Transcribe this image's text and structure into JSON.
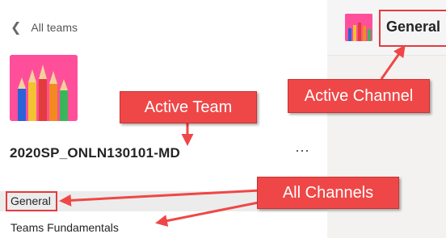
{
  "nav": {
    "back_label": "All teams"
  },
  "team": {
    "name": "2020SP_ONLN130101-MD",
    "more_label": "···"
  },
  "channels": [
    {
      "label": "General"
    },
    {
      "label": "Teams Fundamentals"
    }
  ],
  "header": {
    "channel_title": "General"
  },
  "annotations": {
    "active_team": "Active Team",
    "active_channel": "Active Channel",
    "all_channels": "All Channels"
  },
  "colors": {
    "annotation_red": "#ef4747",
    "tile_background": "#ff4f9a",
    "selected_row": "#ececec"
  }
}
